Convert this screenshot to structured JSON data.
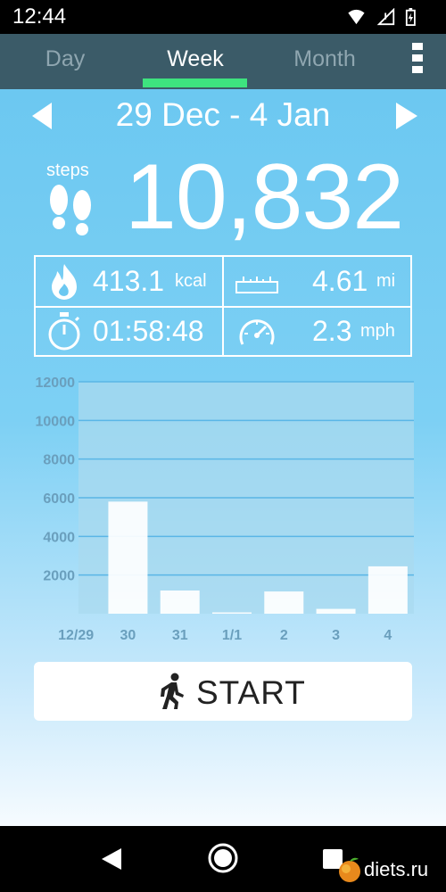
{
  "status_bar": {
    "time": "12:44",
    "icons": [
      "wifi-icon",
      "signal-icon",
      "battery-icon"
    ]
  },
  "tabs": [
    {
      "label": "Day",
      "active": false
    },
    {
      "label": "Week",
      "active": true
    },
    {
      "label": "Month",
      "active": false
    }
  ],
  "date_range": "29 Dec - 4 Jan",
  "steps": {
    "label": "steps",
    "value": "10,832"
  },
  "stats": {
    "calories": {
      "value": "413.1",
      "unit": "kcal",
      "icon": "flame-icon"
    },
    "distance": {
      "value": "4.61",
      "unit": "mi",
      "icon": "ruler-icon"
    },
    "duration": {
      "value": "01:58:48",
      "icon": "stopwatch-icon"
    },
    "speed": {
      "value": "2.3",
      "unit": "mph",
      "icon": "speedometer-icon"
    }
  },
  "chart_data": {
    "type": "bar",
    "categories": [
      "12/29",
      "30",
      "31",
      "1/1",
      "2",
      "3",
      "4"
    ],
    "values": [
      0,
      5800,
      1200,
      50,
      1150,
      250,
      2450
    ],
    "ylim": [
      0,
      12000
    ],
    "yticks": [
      2000,
      4000,
      6000,
      8000,
      10000,
      12000
    ],
    "ytick_labels": [
      "2000",
      "4000",
      "6000",
      "8000",
      "10000",
      "12000"
    ],
    "grid": true,
    "colors": {
      "bar": "#ffffff",
      "plot_bg": "#a9d9ef",
      "grid": "#5ab6e6",
      "label": "#6a9fbd"
    }
  },
  "start_button": {
    "label": "START",
    "icon": "walking-person-icon"
  },
  "watermark": {
    "text": "diets.ru"
  },
  "colors": {
    "accent": "#3ee37f",
    "tab_bar": "#3b5b68",
    "main_bg": "#6cc8f1"
  }
}
